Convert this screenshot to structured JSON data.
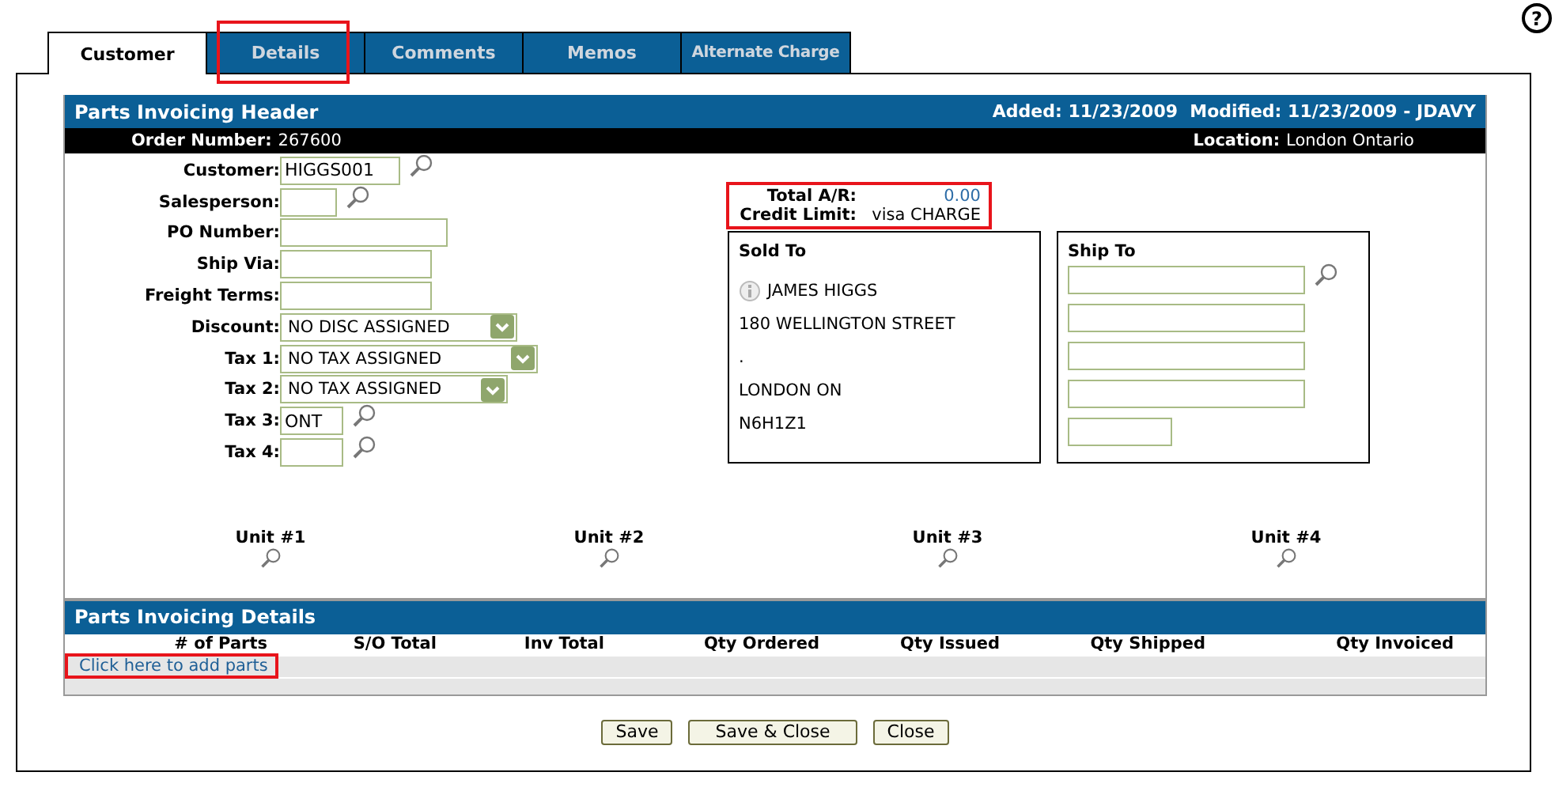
{
  "help_button": {
    "label": "?"
  },
  "tabs": [
    {
      "label": "Customer",
      "selected": true,
      "highlighted": false
    },
    {
      "label": "Details",
      "selected": false,
      "highlighted": true
    },
    {
      "label": "Comments",
      "selected": false,
      "highlighted": false
    },
    {
      "label": "Memos",
      "selected": false,
      "highlighted": false
    },
    {
      "label": "Alternate Charge",
      "selected": false,
      "highlighted": false
    }
  ],
  "header": {
    "title": "Parts Invoicing Header",
    "audit": "Added: 11/23/2009  Modified: 11/23/2009 - JDAVY",
    "order_label": "Order Number:",
    "order_number": "267600",
    "location_label": "Location:",
    "location": "London Ontario"
  },
  "fields": [
    {
      "label": "Customer:",
      "kind": "text",
      "value": "HIGGS001",
      "lookup": true
    },
    {
      "label": "Salesperson:",
      "kind": "text",
      "lookup": true
    },
    {
      "label": "PO Number:",
      "kind": "text",
      "lookup": false
    },
    {
      "label": "Ship Via:",
      "kind": "text",
      "lookup": false
    },
    {
      "label": "Freight Terms:",
      "kind": "text",
      "lookup": false
    },
    {
      "label": "Discount:",
      "kind": "select",
      "value": "NO DISC ASSIGNED",
      "lookup": false
    },
    {
      "label": "Tax 1:",
      "kind": "select",
      "value": "NO TAX ASSIGNED",
      "lookup": false
    },
    {
      "label": "Tax 2:",
      "kind": "select",
      "value": "NO TAX ASSIGNED",
      "lookup": false
    },
    {
      "label": "Tax 3:",
      "kind": "text",
      "value": "ONT",
      "lookup": true
    },
    {
      "label": "Tax 4:",
      "kind": "text",
      "lookup": true
    }
  ],
  "totals": {
    "highlighted": true,
    "rows": [
      {
        "label": "Total A/R:",
        "value": "0.00",
        "kind": "amount"
      },
      {
        "label": "Credit Limit:",
        "value": "visa CHARGE",
        "kind": "text"
      }
    ]
  },
  "sold_to": {
    "title": "Sold To",
    "lines": [
      "JAMES HIGGS",
      "180 WELLINGTON STREET",
      ".",
      "LONDON ON",
      "N6H1Z1"
    ]
  },
  "ship_to": {
    "title": "Ship To"
  },
  "units": [
    "Unit #1",
    "Unit #2",
    "Unit #3",
    "Unit #4"
  ],
  "details": {
    "title": "Parts Invoicing Details",
    "columns": [
      "# of Parts",
      "S/O Total",
      "Inv Total",
      "Qty Ordered",
      "Qty Issued",
      "Qty Shipped",
      "Qty Invoiced"
    ],
    "add_link": {
      "label": "Click here to add parts",
      "highlighted": true
    }
  },
  "buttons": [
    "Save",
    "Save & Close",
    "Close"
  ]
}
